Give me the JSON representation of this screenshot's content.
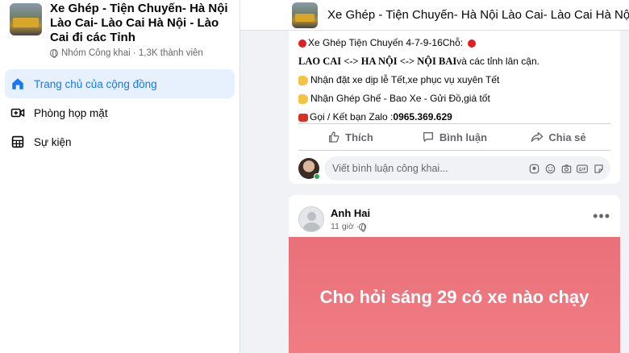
{
  "group": {
    "title": "Xe Ghép - Tiện Chuyến- Hà Nội Lào Cai- Lào Cai Hà Nội - Lào Cai đi các Tỉnh",
    "privacy": "Nhóm Công khai",
    "members": "1,3K thành viên",
    "header_title": "Xe Ghép - Tiện Chuyến- Hà Nội Lào Cai- Lào Cai Hà Nội - L"
  },
  "sidebar": {
    "items": [
      {
        "label": "Trang chủ của cộng đồng",
        "icon": "home-icon",
        "active": true
      },
      {
        "label": "Phòng họp mặt",
        "icon": "video-icon",
        "active": false
      },
      {
        "label": "Sự kiện",
        "icon": "calendar-grid-icon",
        "active": false
      }
    ]
  },
  "post1": {
    "line1": "Xe Ghép Tiện Chuyến 4-7-9-16Chỗ: ",
    "line2_bold": "LAO CAI <-> HA NỘI <-> NỘI BAI",
    "line2_rest": " và các tỉnh lân cận.",
    "line3": "Nhận đặt xe dịp lễ Tết,xe phục vụ xuyên Tết",
    "line4": "Nhận Ghép Ghế - Bao Xe - Gửi Đồ,giá tốt",
    "line5_prefix": "Gọi / Kết bạn Zalo : ",
    "line5_phone": "0965.369.629",
    "actions": {
      "like": "Thích",
      "comment": "Bình luận",
      "share": "Chia sẻ"
    },
    "comment_placeholder": "Viết bình luận công khai..."
  },
  "post2": {
    "author": "Anh Hai",
    "time": "11 giờ · ",
    "text": "Cho hỏi sáng 29 có xe nào chạy",
    "bg_color": "#ea7079"
  },
  "colors": {
    "accent": "#1877f2",
    "active_bg": "#e7f0fd"
  }
}
